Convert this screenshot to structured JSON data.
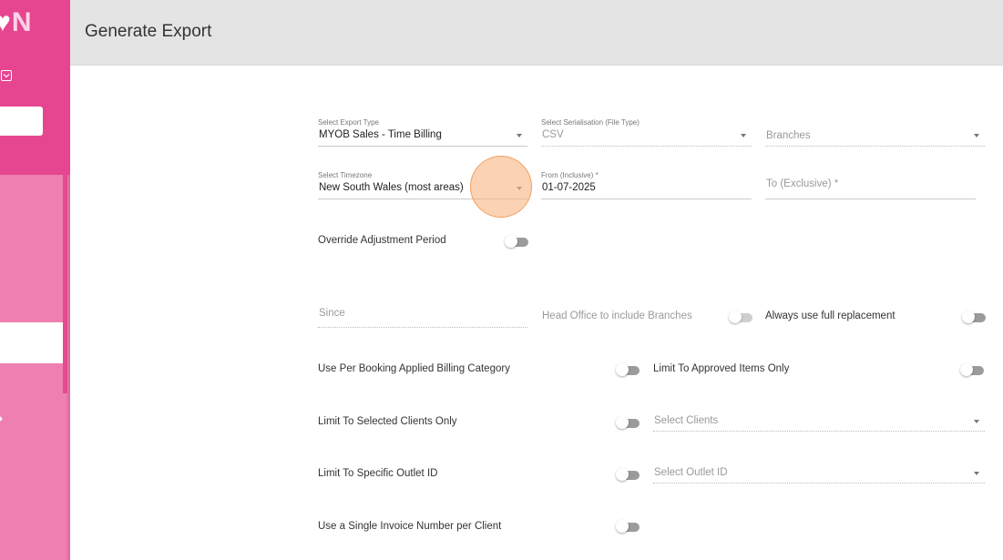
{
  "sidebar": {
    "logo_text": "N",
    "logo_heart": "♥"
  },
  "header": {
    "title": "Generate Export"
  },
  "form": {
    "export_type": {
      "label": "Select Export Type",
      "value": "MYOB Sales - Time Billing"
    },
    "serialisation": {
      "label": "Select Serialisation (File Type)",
      "value": "CSV"
    },
    "branches": {
      "placeholder": "Branches"
    },
    "timezone": {
      "label": "Select Timezone",
      "value": "New South Wales (most areas)"
    },
    "from": {
      "label": "From (Inclusive) *",
      "value": "01-07-2025"
    },
    "to": {
      "placeholder": "To (Exclusive) *"
    },
    "override_adjustment_period": {
      "label": "Override Adjustment Period",
      "on": false
    },
    "since": {
      "placeholder": "Since"
    },
    "head_office_include_branches": {
      "label": "Head Office to include Branches",
      "on": false
    },
    "always_full_replacement": {
      "label": "Always use full replacement",
      "on": false
    },
    "per_booking_billing_category": {
      "label": "Use Per Booking Applied Billing Category",
      "on": false
    },
    "limit_approved_items": {
      "label": "Limit To Approved Items Only",
      "on": false
    },
    "limit_selected_clients": {
      "label": "Limit To Selected Clients Only",
      "on": false
    },
    "select_clients": {
      "placeholder": "Select Clients"
    },
    "limit_specific_outlet": {
      "label": "Limit To Specific Outlet ID",
      "on": false
    },
    "select_outlet": {
      "placeholder": "Select Outlet ID"
    },
    "single_invoice_per_client": {
      "label": "Use a Single Invoice Number per Client",
      "on": false
    }
  },
  "colors": {
    "sidebar_dark": "#e64690",
    "sidebar_light": "#ef7fb0",
    "header_bg": "#e4e4e4",
    "cursor_highlight": "#f8b885"
  }
}
